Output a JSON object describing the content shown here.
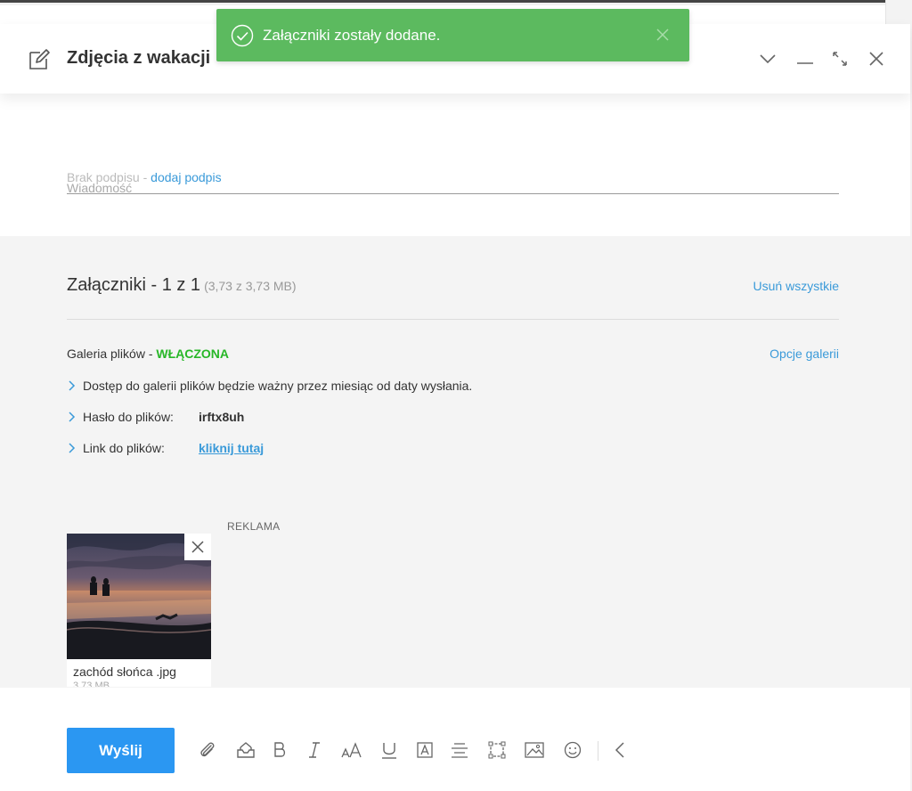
{
  "window": {
    "title": "Zdjęcia z wakacji"
  },
  "toast": {
    "message": "Załączniki zostały dodane."
  },
  "compose": {
    "signature_text": "Brak podpisu - ",
    "signature_link": "dodaj podpis",
    "message_placeholder": "Wiadomość"
  },
  "attachments": {
    "title": "Załączniki - 1 z 1",
    "size": "(3,73 z 3,73 MB)",
    "remove_all": "Usuń wszystkie",
    "gallery_label": "Galeria plików - ",
    "gallery_status": "WŁĄCZONA",
    "gallery_options": "Opcje galerii",
    "access_info": "Dostęp do galerii plików będzie ważny przez miesiąc od daty wysłania.",
    "password_label": "Hasło do plików:",
    "password_value": "irftx8uh",
    "link_label": "Link do plików:",
    "link_value": "kliknij tutaj",
    "ad_label": "REKLAMA",
    "files": [
      {
        "name": "zachód słońca .jpg",
        "size": "3,73 MB"
      }
    ]
  },
  "toolbar": {
    "send_label": "Wyślij"
  },
  "colors": {
    "toast_green": "#5cba5f",
    "link_blue": "#3a9ad9",
    "send_blue": "#2b97f2",
    "status_green": "#28b728"
  }
}
